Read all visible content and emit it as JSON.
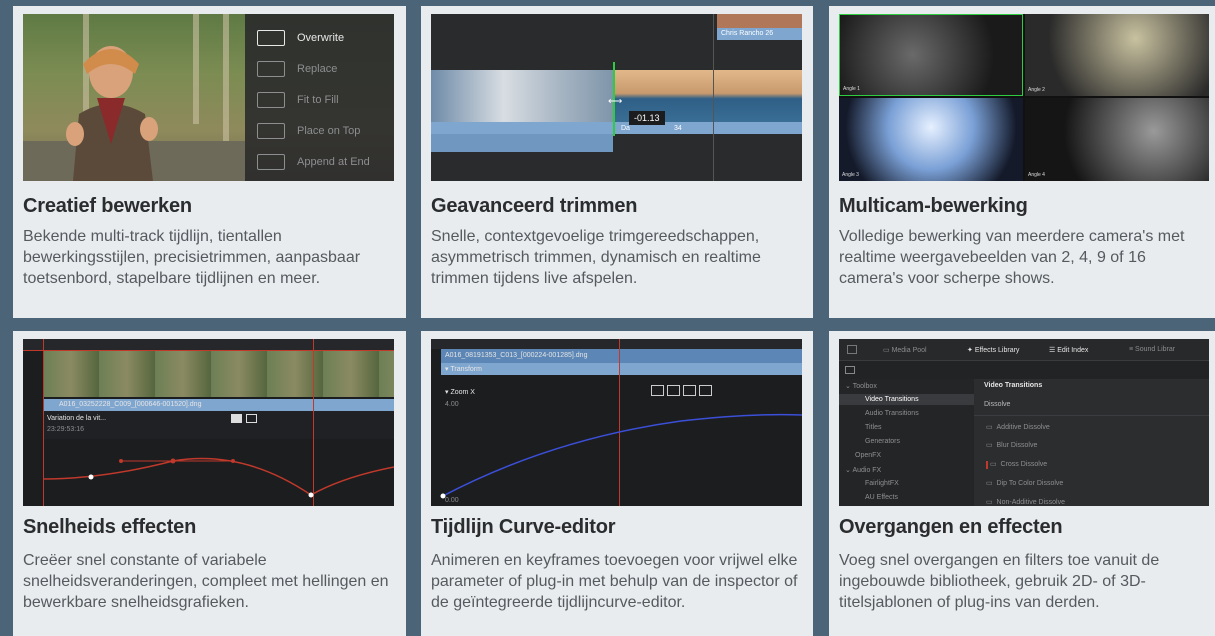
{
  "cards": [
    {
      "title": "Creatief bewerken",
      "desc": "Bekende multi-track tijdlijn, tientallen bewerkingsstijlen, precisietrimmen, aanpasbaar toetsenbord, stapelbare tijdlijnen en meer.",
      "menu": [
        "Overwrite",
        "Replace",
        "Fit to Fill",
        "Place on Top",
        "Append at End"
      ]
    },
    {
      "title": "Geavanceerd trimmen",
      "desc": "Snelle, contextgevoelige trimgereedschappen, asymmetrisch trimmen, dynamisch en realtime trimmen tijdens live afspelen.",
      "clip_name": "Chris Rancho 26",
      "trim_value": "-01.13",
      "clip_fragment_a": "Da",
      "clip_fragment_b": "34"
    },
    {
      "title": "Multicam-bewerking",
      "desc": "Volledige bewerking van meerdere camera's met realtime weergavebeelden van 2, 4, 9 of 16 camera's voor scherpe shows.",
      "angles": [
        "Angle 1",
        "Angle 2",
        "Angle 3",
        "Angle 4"
      ]
    },
    {
      "title": "Snelheids effecten",
      "desc": "Creëer snel constante of variabele snelheidsveranderingen, compleet met hellingen en bewerkbare snelheidsgrafieken.",
      "clip_file": "A016_03252228_C009_[000646-001520].dng",
      "param": "Variation de la vit...",
      "timecode": "23:29:53:16"
    },
    {
      "title": "Tijdlijn Curve-editor",
      "desc": "Animeren en keyframes toevoegen voor vrijwel elke parameter of plug-in met behulp van de inspector of de geïntegreerde tijdlijncurve-editor.",
      "clip_file": "A016_08191353_C013_[000224-001285].dng",
      "group": "Transform",
      "param": "Zoom X",
      "ymax": "4.00",
      "ymin": "0.00"
    },
    {
      "title": "Overgangen en effecten",
      "desc": "Voeg snel overgangen en filters toe vanuit de ingebouwde bibliotheek, gebruik 2D- of 3D-titelsjablonen of plug-ins van derden.",
      "tabs": [
        "Media Pool",
        "Effects Library",
        "Edit Index",
        "Sound Librar"
      ],
      "tree": [
        "Toolbox",
        "Video Transitions",
        "Audio Transitions",
        "Titles",
        "Generators",
        "OpenFX",
        "Audio FX",
        "FairlightFX",
        "AU Effects"
      ],
      "panel_title": "Video Transitions",
      "section": "Dissolve",
      "items": [
        "Additive Dissolve",
        "Blur Dissolve",
        "Cross Dissolve",
        "Dip To Color Dissolve",
        "Non-Additive Dissolve"
      ]
    }
  ],
  "colors": {
    "background": "#4b6478",
    "card": "#e9ecef",
    "title": "#2a2c2e",
    "text": "#555a5e",
    "timeline_blue": "#7fa6cf",
    "playhead": "#c0392b",
    "trim_green": "#2ecc40"
  }
}
